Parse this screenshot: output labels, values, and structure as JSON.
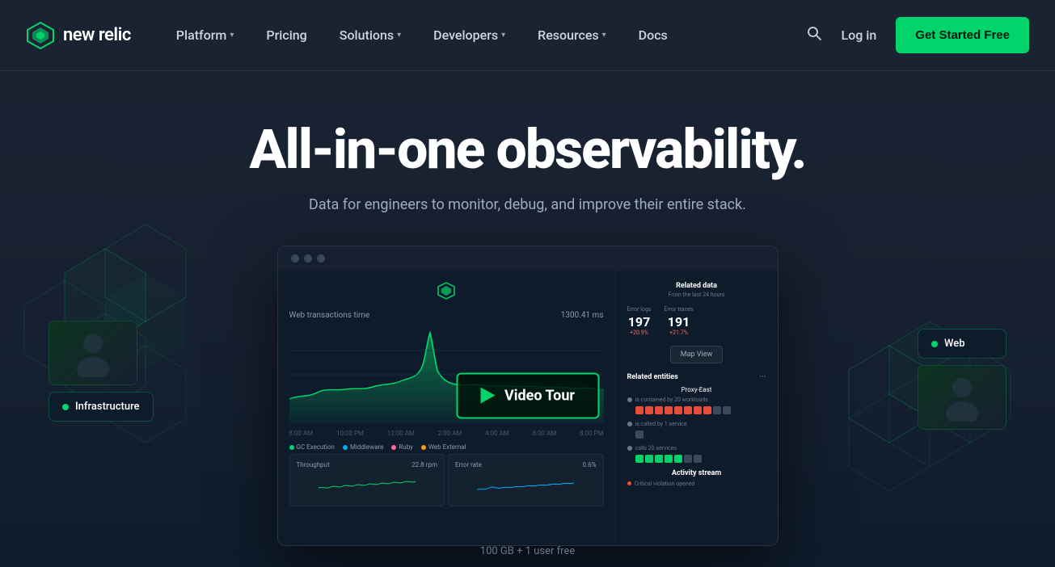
{
  "navbar": {
    "logo_text": "new relic",
    "nav_items": [
      {
        "label": "Platform",
        "has_chevron": true
      },
      {
        "label": "Pricing",
        "has_chevron": false
      },
      {
        "label": "Solutions",
        "has_chevron": true
      },
      {
        "label": "Developers",
        "has_chevron": true
      },
      {
        "label": "Resources",
        "has_chevron": true
      },
      {
        "label": "Docs",
        "has_chevron": false
      }
    ],
    "login_label": "Log in",
    "cta_label": "Get Started Free"
  },
  "hero": {
    "title": "All-in-one observability.",
    "subtitle": "Data for engineers to monitor, debug, and improve their entire stack."
  },
  "dashboard": {
    "chart_title": "Web transactions time",
    "chart_value": "1300.41 ms",
    "legend": [
      {
        "label": "GC Execution",
        "color": "#00d46a"
      },
      {
        "label": "Middleware",
        "color": "#00aaff"
      },
      {
        "label": "Ruby",
        "color": "#ff6b9d"
      },
      {
        "label": "Web External",
        "color": "#f59e0b"
      }
    ],
    "sub_charts": [
      {
        "title": "Throughput",
        "value": "22.8 rpm"
      },
      {
        "title": "Error rate",
        "value": "0.6%"
      }
    ],
    "related": {
      "title": "Related data",
      "subtitle": "From the last 24 hours",
      "error_logs_label": "Error logs",
      "error_logs_value": "197",
      "error_logs_change": "+20.9%",
      "error_traces_label": "Error traces",
      "error_traces_value": "191",
      "error_traces_change": "+21.7%",
      "map_view_label": "Map View",
      "related_entities_label": "Related entities",
      "entity_name": "Proxy-East",
      "entity_contained": "is contained by 20 workloads",
      "entity_called": "is called by 1 service",
      "entity_calls": "calls 20 services",
      "activity_title": "Activity stream",
      "activity_item": "Critical violation opened"
    }
  },
  "video_tour": {
    "label": "Video Tour"
  },
  "floating": {
    "infrastructure_label": "Infrastructure",
    "web_label": "Web"
  },
  "bottom": {
    "text": "100 GB + 1 user free"
  }
}
